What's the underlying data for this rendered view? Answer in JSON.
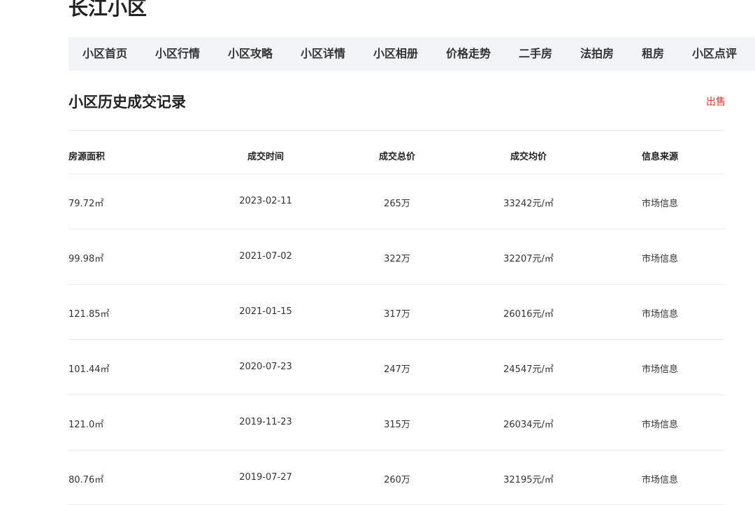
{
  "community": {
    "name": "长江小区"
  },
  "nav": {
    "items": [
      {
        "label": "小区首页"
      },
      {
        "label": "小区行情"
      },
      {
        "label": "小区攻略"
      },
      {
        "label": "小区详情"
      },
      {
        "label": "小区相册"
      },
      {
        "label": "价格走势"
      },
      {
        "label": "二手房"
      },
      {
        "label": "法拍房"
      },
      {
        "label": "租房"
      },
      {
        "label": "小区点评"
      }
    ]
  },
  "section": {
    "title": "小区历史成交记录",
    "sale_link": "出售"
  },
  "table": {
    "headers": {
      "area": "房源面积",
      "date": "成交时间",
      "total": "成交总价",
      "unit": "成交均价",
      "source": "信息来源"
    },
    "rows": [
      {
        "area": "79.72㎡",
        "date": "2023-02-11",
        "total": "265万",
        "unit": "33242元/㎡",
        "source": "市场信息"
      },
      {
        "area": "99.98㎡",
        "date": "2021-07-02",
        "total": "322万",
        "unit": "32207元/㎡",
        "source": "市场信息"
      },
      {
        "area": "121.85㎡",
        "date": "2021-01-15",
        "total": "317万",
        "unit": "26016元/㎡",
        "source": "市场信息"
      },
      {
        "area": "101.44㎡",
        "date": "2020-07-23",
        "total": "247万",
        "unit": "24547元/㎡",
        "source": "市场信息"
      },
      {
        "area": "121.0㎡",
        "date": "2019-11-23",
        "total": "315万",
        "unit": "26034元/㎡",
        "source": "市场信息"
      },
      {
        "area": "80.76㎡",
        "date": "2019-07-27",
        "total": "260万",
        "unit": "32195元/㎡",
        "source": "市场信息"
      }
    ]
  }
}
